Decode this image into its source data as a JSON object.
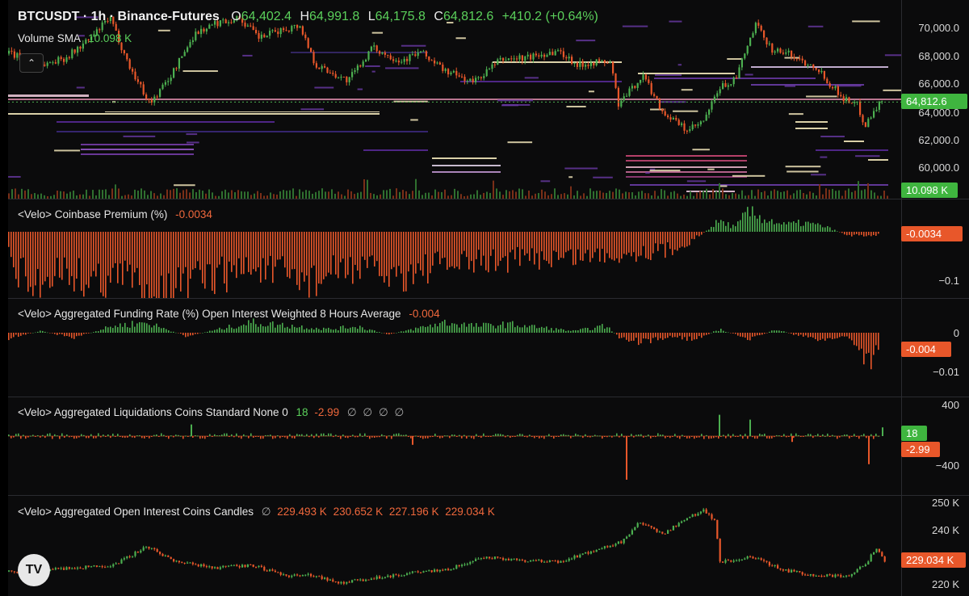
{
  "header": {
    "symbol": "BTCUSDT · 1h · Binance-Futures",
    "open_label": "O",
    "open": "64,402.4",
    "high_label": "H",
    "high": "64,991.8",
    "low_label": "L",
    "low": "64,175.8",
    "close_label": "C",
    "close": "64,812.6",
    "change": "+410.2 (+0.64%)",
    "volume_label": "Volume SMA",
    "volume_value": "10.098 K"
  },
  "colors": {
    "up": "#4caf50",
    "down": "#e8572a",
    "background": "#0b0b0c",
    "heatmap_bright": "#fff3c4",
    "heatmap_purple": "#5b2c9c"
  },
  "icons": {
    "collapse": "chevron-up-icon",
    "logo": "tradingview-logo"
  },
  "chart_data": [
    {
      "id": "price",
      "type": "candlestick",
      "title": "BTCUSDT · 1h · Binance-Futures",
      "ylim": [
        58500,
        71500
      ],
      "yticks": [
        "70,000.0",
        "68,000.0",
        "66,000.0",
        "64,000.0",
        "62,000.0",
        "60,000.0"
      ],
      "ytick_values": [
        70000,
        68000,
        66000,
        64000,
        62000,
        60000
      ],
      "last_price": 64812.6,
      "last_label": "64,812.6",
      "volume_badge": "10.098 K",
      "anchors": [
        [
          0,
          68200
        ],
        [
          40,
          67400
        ],
        [
          70,
          67900
        ],
        [
          100,
          69200
        ],
        [
          125,
          70700
        ],
        [
          150,
          67200
        ],
        [
          175,
          64700
        ],
        [
          200,
          66600
        ],
        [
          230,
          69600
        ],
        [
          260,
          70400
        ],
        [
          285,
          70700
        ],
        [
          310,
          69300
        ],
        [
          335,
          69800
        ],
        [
          360,
          70200
        ],
        [
          380,
          67400
        ],
        [
          420,
          66300
        ],
        [
          450,
          68600
        ],
        [
          485,
          67700
        ],
        [
          510,
          68300
        ],
        [
          540,
          67000
        ],
        [
          575,
          66200
        ],
        [
          610,
          67800
        ],
        [
          640,
          67900
        ],
        [
          680,
          68400
        ],
        [
          705,
          67400
        ],
        [
          720,
          67600
        ],
        [
          745,
          67600
        ],
        [
          755,
          64600
        ],
        [
          785,
          66700
        ],
        [
          810,
          64100
        ],
        [
          840,
          62800
        ],
        [
          860,
          63400
        ],
        [
          880,
          65800
        ],
        [
          900,
          66400
        ],
        [
          915,
          68800
        ],
        [
          925,
          70200
        ],
        [
          945,
          68500
        ],
        [
          965,
          68200
        ],
        [
          985,
          67600
        ],
        [
          1000,
          67300
        ],
        [
          1015,
          66200
        ],
        [
          1035,
          65000
        ],
        [
          1050,
          64700
        ],
        [
          1060,
          63200
        ],
        [
          1075,
          64500
        ],
        [
          1080,
          64800
        ]
      ]
    },
    {
      "id": "premium",
      "type": "histogram",
      "title": "<Velo> Coinbase Premium (%)",
      "value_label": "-0.0034",
      "yticks": [
        "−0.1"
      ],
      "badge": "-0.0034",
      "anchors": [
        [
          0,
          -0.03
        ],
        [
          30,
          -0.065
        ],
        [
          60,
          -0.04
        ],
        [
          100,
          -0.055
        ],
        [
          150,
          -0.05
        ],
        [
          180,
          -0.075
        ],
        [
          220,
          -0.06
        ],
        [
          260,
          -0.05
        ],
        [
          300,
          -0.04
        ],
        [
          340,
          -0.05
        ],
        [
          380,
          -0.055
        ],
        [
          420,
          -0.04
        ],
        [
          480,
          -0.05
        ],
        [
          520,
          -0.04
        ],
        [
          580,
          -0.035
        ],
        [
          640,
          -0.03
        ],
        [
          700,
          -0.028
        ],
        [
          760,
          -0.025
        ],
        [
          820,
          -0.02
        ],
        [
          850,
          -0.008
        ],
        [
          880,
          0.012
        ],
        [
          900,
          0.005
        ],
        [
          915,
          0.022
        ],
        [
          935,
          0.015
        ],
        [
          960,
          0.008
        ],
        [
          985,
          0.01
        ],
        [
          1010,
          0.006
        ],
        [
          1040,
          -0.004
        ],
        [
          1080,
          -0.0034
        ]
      ]
    },
    {
      "id": "funding",
      "type": "histogram",
      "title": "<Velo> Aggregated Funding Rate (%) Open Interest Weighted 8 Hours Average",
      "value_label": "-0.004",
      "yticks": [
        "0",
        "−0.01"
      ],
      "badge": "-0.004",
      "anchors": [
        [
          0,
          -0.0015
        ],
        [
          40,
          0.0005
        ],
        [
          80,
          -0.0015
        ],
        [
          130,
          0.002
        ],
        [
          170,
          0.003
        ],
        [
          220,
          -0.001
        ],
        [
          260,
          0.001
        ],
        [
          300,
          0.003
        ],
        [
          350,
          0.002
        ],
        [
          400,
          0.001
        ],
        [
          430,
          0.002
        ],
        [
          470,
          -0.0005
        ],
        [
          500,
          0.001
        ],
        [
          540,
          0.003
        ],
        [
          580,
          0.002
        ],
        [
          620,
          0.0025
        ],
        [
          660,
          0.0015
        ],
        [
          700,
          0.0005
        ],
        [
          740,
          0.002
        ],
        [
          760,
          -0.002
        ],
        [
          790,
          -0.003
        ],
        [
          820,
          -0.001
        ],
        [
          850,
          -0.002
        ],
        [
          880,
          0.001
        ],
        [
          920,
          -0.002
        ],
        [
          950,
          0.001
        ],
        [
          980,
          -0.001
        ],
        [
          1010,
          -0.002
        ],
        [
          1040,
          -0.001
        ],
        [
          1065,
          -0.0085
        ],
        [
          1080,
          -0.004
        ]
      ]
    },
    {
      "id": "liquidations",
      "type": "histogram",
      "title": "<Velo> Aggregated Liquidations Coins Standard None 0",
      "value_label_up": "18",
      "value_label_down": "-2.99",
      "na_labels": [
        "∅",
        "∅",
        "∅",
        "∅"
      ],
      "yticks": [
        "400",
        "−400"
      ],
      "badge_up": "18",
      "badge_down": "-2.99",
      "spikes": [
        [
          226,
          120
        ],
        [
          500,
          -90
        ],
        [
          765,
          -450
        ],
        [
          880,
          220
        ],
        [
          918,
          170
        ],
        [
          970,
          -60
        ],
        [
          1065,
          -290
        ],
        [
          1082,
          90
        ]
      ]
    },
    {
      "id": "open_interest",
      "type": "candlestick",
      "title": "<Velo> Aggregated Open Interest Coins Candles",
      "na_label": "∅",
      "ohlc_labels": [
        "229.493 K",
        "230.652 K",
        "227.196 K",
        "229.034 K"
      ],
      "yticks": [
        "250 K",
        "240 K",
        "220 K"
      ],
      "ytick_values": [
        250,
        240,
        220
      ],
      "ylim": [
        218,
        252
      ],
      "badge": "229.034 K",
      "anchors": [
        [
          0,
          225.5
        ],
        [
          60,
          226.5
        ],
        [
          130,
          228
        ],
        [
          170,
          235
        ],
        [
          210,
          229
        ],
        [
          260,
          227
        ],
        [
          300,
          228
        ],
        [
          340,
          224
        ],
        [
          380,
          224
        ],
        [
          410,
          221
        ],
        [
          450,
          223
        ],
        [
          500,
          225
        ],
        [
          540,
          226
        ],
        [
          590,
          231
        ],
        [
          630,
          230
        ],
        [
          680,
          229
        ],
        [
          720,
          233
        ],
        [
          760,
          237
        ],
        [
          780,
          244
        ],
        [
          810,
          240
        ],
        [
          840,
          246
        ],
        [
          860,
          249
        ],
        [
          875,
          245
        ],
        [
          880,
          229
        ],
        [
          920,
          231
        ],
        [
          960,
          226
        ],
        [
          1000,
          224
        ],
        [
          1040,
          224
        ],
        [
          1060,
          228
        ],
        [
          1075,
          235
        ],
        [
          1085,
          229
        ]
      ]
    }
  ]
}
